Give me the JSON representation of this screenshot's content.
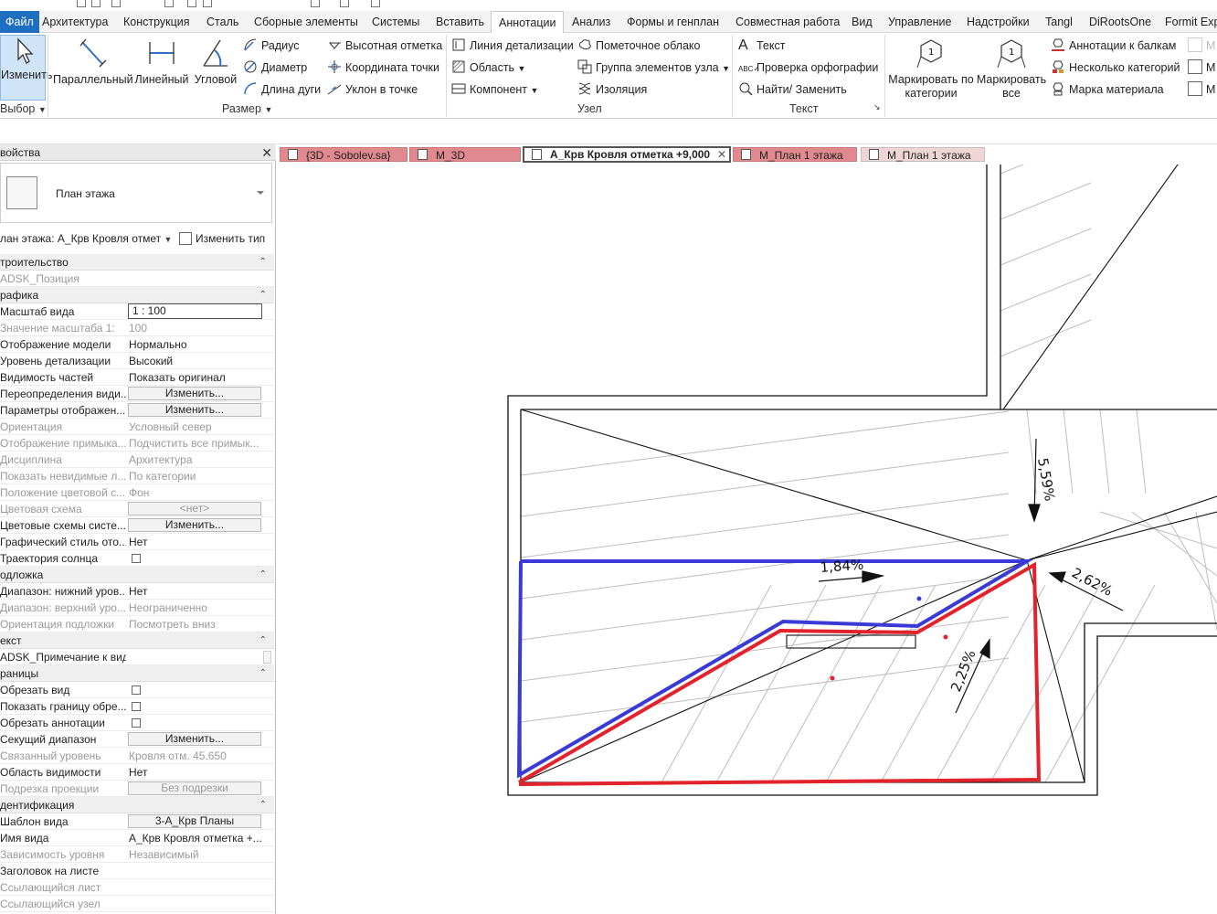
{
  "menu": {
    "file": "Файл",
    "tabs": [
      "Архитектура",
      "Конструкция",
      "Сталь",
      "Сборные элементы",
      "Системы",
      "Вставить",
      "Аннотации",
      "Анализ",
      "Формы и генплан",
      "Совместная работа",
      "Вид",
      "Управление",
      "Надстройки",
      "Tangl",
      "DiRootsOne",
      "Formit Exp"
    ],
    "active_tab": "Аннотации"
  },
  "ribbon": {
    "modify_label": "Изменить",
    "select_label": "Выбор",
    "dim_big": [
      "Параллельный",
      "Линейный",
      "Угловой"
    ],
    "dim_small": [
      "Радиус",
      "Диаметр",
      "Длина дуги",
      "Высотная отметка",
      "Координата точки",
      "Уклон  в точке"
    ],
    "dim_panel": "Размер",
    "detail_small": [
      "Линия детализации",
      "Область",
      "Компонент",
      "Пометочное облако",
      "Группа элементов узла",
      "Изоляция"
    ],
    "detail_panel": "Узел",
    "text_small": [
      "Текст",
      "Проверка  орфографии",
      "Найти/ Заменить"
    ],
    "text_panel": "Текст",
    "tag_big": [
      "Маркировать по категории",
      "Маркировать все"
    ],
    "tag_small": [
      "Аннотации к балкам",
      "Несколько категорий",
      "Марка материала"
    ]
  },
  "properties": {
    "title": "войства",
    "type_name": "План этажа",
    "instance_selector": "лан этажа: А_Крв Кровля отмет",
    "edit_type": "Изменить тип",
    "rows": [
      {
        "kind": "group",
        "k": "троительство"
      },
      {
        "kind": "grey",
        "k": "ADSK_Позиция",
        "v": ""
      },
      {
        "kind": "group",
        "k": "рафика"
      },
      {
        "kind": "input",
        "k": "Масштаб вида",
        "v": "1 : 100"
      },
      {
        "kind": "grey",
        "k": "Значение масштаба    1:",
        "v": "100"
      },
      {
        "kind": "plain",
        "k": "Отображение модели",
        "v": "Нормально"
      },
      {
        "kind": "plain",
        "k": "Уровень детализации",
        "v": "Высокий"
      },
      {
        "kind": "plain",
        "k": "Видимость частей",
        "v": "Показать оригинал"
      },
      {
        "kind": "button",
        "k": "Переопределения види...",
        "v": "Изменить..."
      },
      {
        "kind": "button",
        "k": "Параметры отображен...",
        "v": "Изменить..."
      },
      {
        "kind": "grey",
        "k": "Ориентация",
        "v": "Условный север"
      },
      {
        "kind": "grey",
        "k": "Отображение примыка...",
        "v": "Подчистить все примык..."
      },
      {
        "kind": "grey",
        "k": "Дисциплина",
        "v": "Архитектура"
      },
      {
        "kind": "grey",
        "k": "Показать невидимые л...",
        "v": "По категории"
      },
      {
        "kind": "grey",
        "k": "Положение цветовой с...",
        "v": "Фон"
      },
      {
        "kind": "greybutton",
        "k": "Цветовая схема",
        "v": "<нет>"
      },
      {
        "kind": "button",
        "k": "Цветовые схемы систе...",
        "v": "Изменить..."
      },
      {
        "kind": "plain",
        "k": "Графический стиль ото...",
        "v": "Нет"
      },
      {
        "kind": "check",
        "k": "Траектория солнца",
        "v": ""
      },
      {
        "kind": "group",
        "k": "одложка"
      },
      {
        "kind": "plain",
        "k": "Диапазон: нижний уров...",
        "v": "Нет"
      },
      {
        "kind": "grey",
        "k": "Диапазон: верхний уро...",
        "v": "Неограниченно"
      },
      {
        "kind": "grey",
        "k": "Ориентация подложки",
        "v": "Посмотреть вниз"
      },
      {
        "kind": "group",
        "k": "екст"
      },
      {
        "kind": "scroll",
        "k": "ADSK_Примечание к виду",
        "v": ""
      },
      {
        "kind": "group",
        "k": "раницы"
      },
      {
        "kind": "check",
        "k": "Обрезать вид",
        "v": ""
      },
      {
        "kind": "check",
        "k": "Показать границу обре...",
        "v": ""
      },
      {
        "kind": "check",
        "k": "Обрезать аннотации",
        "v": ""
      },
      {
        "kind": "button",
        "k": "Секущий диапазон",
        "v": "Изменить..."
      },
      {
        "kind": "grey",
        "k": "Связанный уровень",
        "v": "Кровля отм. 45.650"
      },
      {
        "kind": "plain",
        "k": "Область видимости",
        "v": "Нет"
      },
      {
        "kind": "greybutton",
        "k": "Подрезка проекции",
        "v": "Без подрезки"
      },
      {
        "kind": "group",
        "k": "дентификация"
      },
      {
        "kind": "button",
        "k": "Шаблон вида",
        "v": "3-А_Крв Планы"
      },
      {
        "kind": "plain",
        "k": "Имя вида",
        "v": "А_Крв Кровля отметка +..."
      },
      {
        "kind": "grey",
        "k": "Зависимость уровня",
        "v": "Независимый"
      },
      {
        "kind": "plain",
        "k": "Заголовок на листе",
        "v": ""
      },
      {
        "kind": "grey",
        "k": "Ссылающийся лист",
        "v": ""
      },
      {
        "kind": "grey",
        "k": "Ссылающийся узел",
        "v": ""
      }
    ]
  },
  "view_tabs": [
    {
      "label": "{3D - Sobolev.sa}",
      "state": "inactive"
    },
    {
      "label": "М_3D",
      "state": "inactive"
    },
    {
      "label": "А_Крв Кровля отметка +9,000",
      "state": "active"
    },
    {
      "label": "М_План 1 этажа",
      "state": "inactive"
    },
    {
      "label": "М_План 1 этажа",
      "state": "light"
    }
  ],
  "drawing": {
    "slopes": [
      "5,59%",
      "1,84%",
      "2,62%",
      "2,25%"
    ],
    "colors": {
      "blue": "#3a3ad6",
      "red": "#e3232b",
      "line": "#111111",
      "hatch": "#bdbdbd"
    }
  }
}
